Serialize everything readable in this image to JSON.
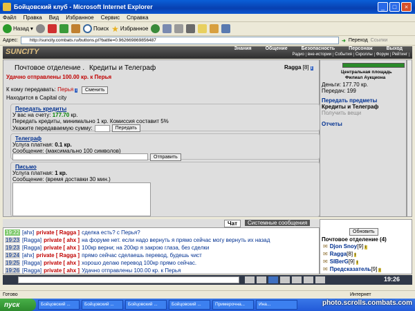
{
  "window": {
    "title": "Бойцовский клуб - Microsoft Internet Explorer"
  },
  "menu": [
    "Файл",
    "Правка",
    "Вид",
    "Избранное",
    "Сервис",
    "Справка"
  ],
  "toolbar": {
    "back": "Назад",
    "search": "Поиск",
    "favorites": "Избранное"
  },
  "address": {
    "label": "Адрес:",
    "url": "http://suncity.combats.ru/buttons.pl?battle=0.962669869856487",
    "go": "Переход",
    "links": "Ссылки"
  },
  "site": {
    "logo": "SUNCITY",
    "nav": [
      "Знания",
      "Общение",
      "Безопасность",
      "Персонаж",
      "Выход"
    ],
    "subnav": [
      "Радио",
      "вне-истории",
      "События",
      "Скроллы",
      "Форум",
      "Рейтинг"
    ]
  },
  "page": {
    "title": "Почтовое отделение .",
    "subtitle": "Кредиты и Телеграф",
    "status": "Удачно отправлены 100.00 кр. к Перья",
    "user": "Ragga",
    "user_level": "[8]",
    "recipient_label": "К кому передавать:",
    "recipient": "Перья",
    "change_btn": "Сменить",
    "location": "Находится в Capital city"
  },
  "credits": {
    "title": "Передать кредиты",
    "balance_label": "У вас на счету:",
    "balance": "177.70",
    "balance_unit": "кр.",
    "note": "Передать кредиты, минимально 1 кр. Комиссия составит 5%",
    "amount_label": "Укажите передаваемую сумму:",
    "transfer_btn": "Передать"
  },
  "telegraph": {
    "title": "Телеграф",
    "price_label": "Услуга платная:",
    "price": "0.1 кр.",
    "msg_label": "Сообщение: (максимально 100 символов)",
    "send_btn": "Отправить"
  },
  "letter": {
    "title": "Письмо",
    "price_label": "Услуга платная:",
    "price": "1 кр.",
    "msg_label": "Сообщение: (время доставки 30 мин.)"
  },
  "side": {
    "loc1": "Центральная площадь",
    "loc2": "Филиал Аукциона",
    "money": "Деньги: 177.70 кр.",
    "transfers": "Передач: 199",
    "items_link": "Передать предметы",
    "current": "Кредиты и Телеграф",
    "receive": "Получить вещи",
    "reports": "Отчеты"
  },
  "chat": {
    "tab_chat": "Чат",
    "tab_system": "Системные сообщения",
    "lines": [
      {
        "time": "19:22",
        "from": "[ahx]",
        "to": "private [ Ragga ]",
        "text": "сделка есть? с Перья?"
      },
      {
        "time": "19:23",
        "from": "[Ragga]",
        "to": "private [ ahx ]",
        "text": "на форуме нет. если надо вернуть я прямо сейчас могу вернуть их назад"
      },
      {
        "time": "19:23",
        "from": "[Ragga]",
        "to": "private [ ahx ]",
        "text": "100кр верни; на 200кр я закрою глаза, без сделки"
      },
      {
        "time": "19:24",
        "from": "[ahx]",
        "to": "private [ Ragga ]",
        "text": "прямо сейчас сделаешь перевод, будешь чист"
      },
      {
        "time": "19:25",
        "from": "[Ragga]",
        "to": "private [ ahx ]",
        "text": "хорошо делаю перевод 100кр прямо сейчас."
      },
      {
        "time": "19:26",
        "from": "[Ragga]",
        "to": "private [ ahx ]",
        "text": "Удачно отправлены 100.00 кр. к Перья"
      }
    ]
  },
  "online": {
    "refresh_btn": "Обновить",
    "title": "Почтовое отделение (4)",
    "users": [
      {
        "name": "Djon Snoy",
        "lvl": "[9]"
      },
      {
        "name": "Ragga",
        "lvl": "[8]"
      },
      {
        "name": "SIBerG",
        "lvl": "[9]"
      },
      {
        "name": "Предсказатель",
        "lvl": "[9]"
      }
    ]
  },
  "clock": "19:26",
  "statusbar": {
    "text": "Готово",
    "zone": "Интернет"
  },
  "taskbar": {
    "start": "пуск",
    "tasks": [
      "Бойцовский ...",
      "Бойцовский ...",
      "Бойцовский ...",
      "Бойцовский ...",
      "Примерочна...",
      "Ина..."
    ]
  },
  "watermark": "photo.scrolls.combats.com"
}
